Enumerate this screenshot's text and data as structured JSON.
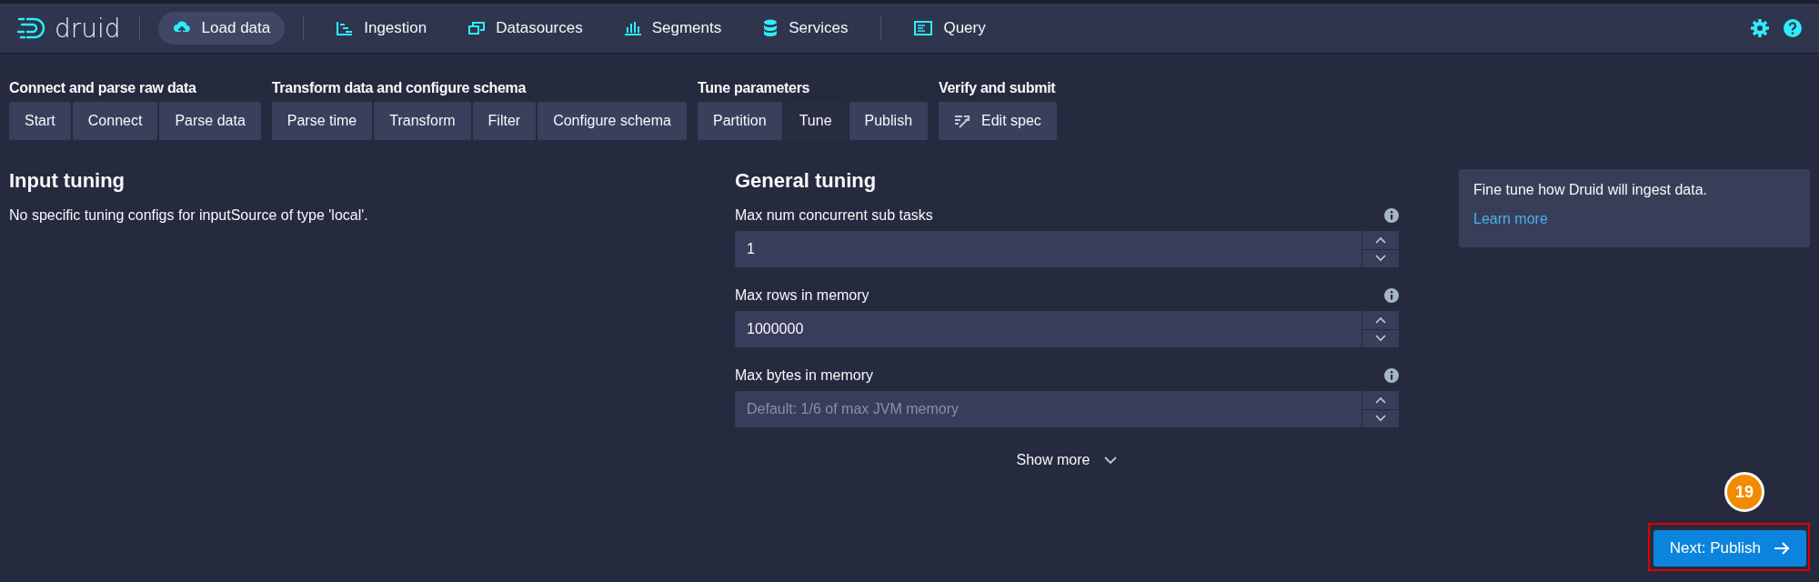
{
  "nav": {
    "logo": "druid",
    "items": [
      {
        "label": "Load data",
        "kind": "upload",
        "selected": true
      },
      {
        "label": "Ingestion",
        "kind": "gantt",
        "selected": false
      },
      {
        "label": "Datasources",
        "kind": "stack",
        "selected": false
      },
      {
        "label": "Segments",
        "kind": "bars",
        "selected": false
      },
      {
        "label": "Services",
        "kind": "database",
        "selected": false
      },
      {
        "label": "Query",
        "kind": "console",
        "selected": false
      }
    ]
  },
  "steps": [
    {
      "title": "Connect and parse raw data",
      "buttons": [
        {
          "label": "Start",
          "kind": "plain",
          "selected": false
        },
        {
          "label": "Connect",
          "kind": "plain",
          "selected": false
        },
        {
          "label": "Parse data",
          "kind": "plain",
          "selected": false
        }
      ]
    },
    {
      "title": "Transform data and configure schema",
      "buttons": [
        {
          "label": "Parse time",
          "kind": "plain",
          "selected": false
        },
        {
          "label": "Transform",
          "kind": "plain",
          "selected": false
        },
        {
          "label": "Filter",
          "kind": "plain",
          "selected": false
        },
        {
          "label": "Configure schema",
          "kind": "plain",
          "selected": false
        }
      ]
    },
    {
      "title": "Tune parameters",
      "buttons": [
        {
          "label": "Partition",
          "kind": "plain",
          "selected": false
        },
        {
          "label": "Tune",
          "kind": "plain",
          "selected": true
        },
        {
          "label": "Publish",
          "kind": "plain",
          "selected": false
        }
      ]
    },
    {
      "title": "Verify and submit",
      "buttons": [
        {
          "label": "Edit spec",
          "kind": "edit",
          "selected": false
        }
      ]
    }
  ],
  "input_tuning": {
    "title": "Input tuning",
    "message": "No specific tuning configs for inputSource of type 'local'."
  },
  "general_tuning": {
    "title": "General tuning",
    "fields": [
      {
        "label": "Max num concurrent sub tasks",
        "value": "1"
      },
      {
        "label": "Max rows in memory",
        "value": "1000000"
      },
      {
        "label": "Max bytes in memory",
        "placeholder": "Default: 1/6 of max JVM memory"
      }
    ],
    "show_more": "Show more"
  },
  "info_panel": {
    "text": "Fine tune how Druid will ingest data.",
    "link": "Learn more"
  },
  "next_button": "Next: Publish",
  "callout": "19"
}
